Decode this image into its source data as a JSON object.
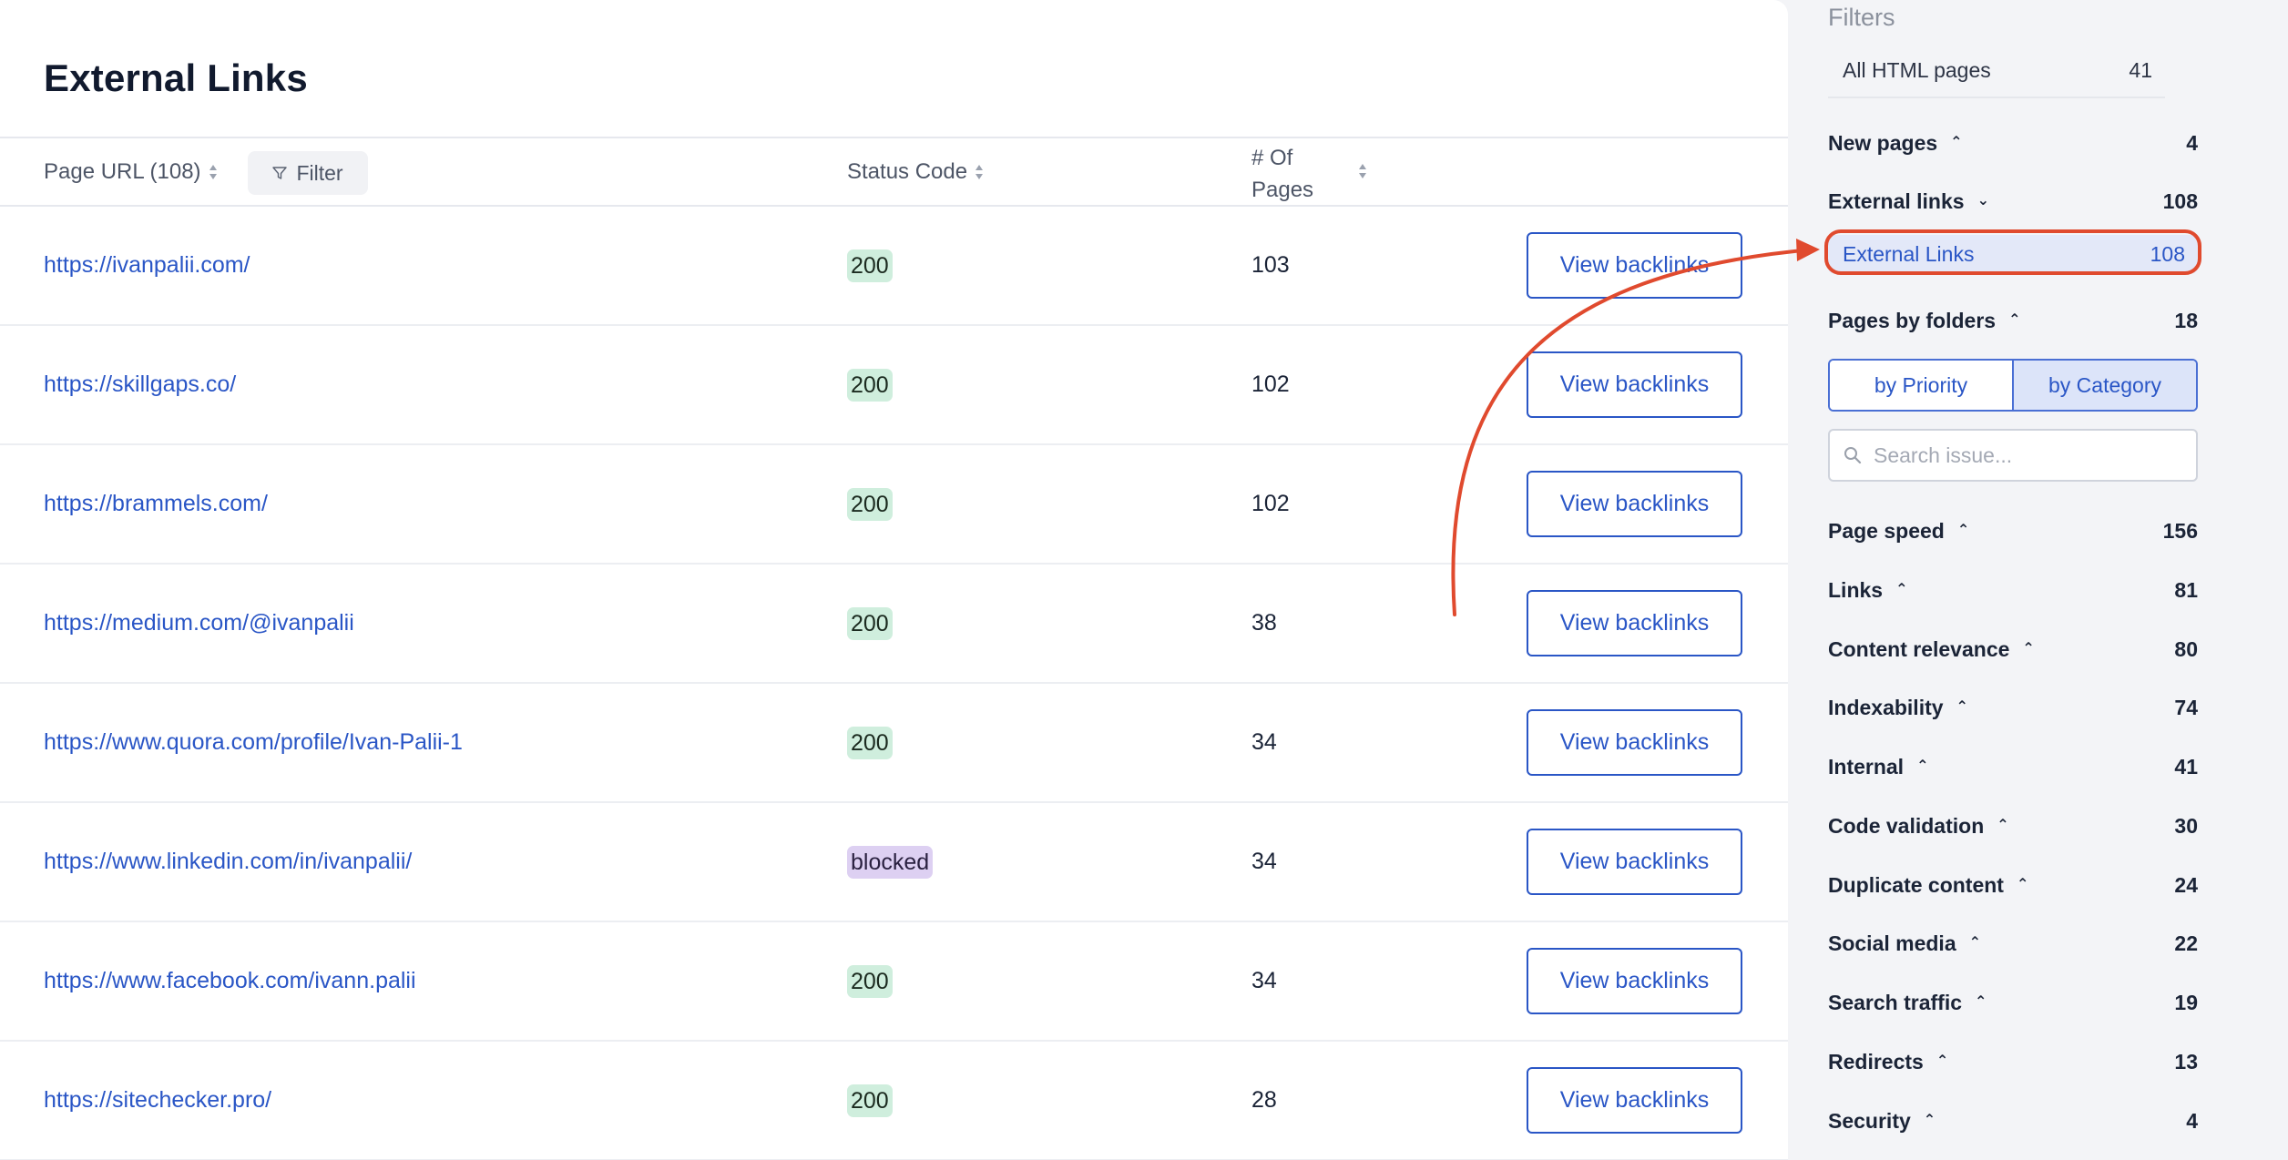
{
  "main": {
    "title": "External Links",
    "columns": {
      "url": "Page URL (108)",
      "filter": "Filter",
      "status": "Status Code",
      "pages": "# Of Pages"
    },
    "rows": [
      {
        "url": "https://ivanpalii.com/",
        "status": "200",
        "status_type": "ok",
        "pages": "103",
        "action": "View backlinks"
      },
      {
        "url": "https://skillgaps.co/",
        "status": "200",
        "status_type": "ok",
        "pages": "102",
        "action": "View backlinks"
      },
      {
        "url": "https://brammels.com/",
        "status": "200",
        "status_type": "ok",
        "pages": "102",
        "action": "View backlinks"
      },
      {
        "url": "https://medium.com/@ivanpalii",
        "status": "200",
        "status_type": "ok",
        "pages": "38",
        "action": "View backlinks"
      },
      {
        "url": "https://www.quora.com/profile/Ivan-Palii-1",
        "status": "200",
        "status_type": "ok",
        "pages": "34",
        "action": "View backlinks"
      },
      {
        "url": "https://www.linkedin.com/in/ivanpalii/",
        "status": "blocked",
        "status_type": "blocked",
        "pages": "34",
        "action": "View backlinks"
      },
      {
        "url": "https://www.facebook.com/ivann.palii",
        "status": "200",
        "status_type": "ok",
        "pages": "34",
        "action": "View backlinks"
      },
      {
        "url": "https://sitechecker.pro/",
        "status": "200",
        "status_type": "ok",
        "pages": "28",
        "action": "View backlinks"
      }
    ]
  },
  "sidebar": {
    "title": "Filters",
    "all": {
      "label": "All HTML pages",
      "count": "41"
    },
    "new_pages": {
      "label": "New pages",
      "count": "4"
    },
    "external_links": {
      "label": "External links",
      "count": "108"
    },
    "external_links_sub": {
      "label": "External Links",
      "count": "108"
    },
    "pages_by_folders": {
      "label": "Pages by folders",
      "count": "18"
    },
    "segmented": {
      "priority": "by Priority",
      "category": "by Category",
      "active": "category"
    },
    "search": {
      "placeholder": "Search issue..."
    },
    "categories": [
      {
        "label": "Page speed",
        "count": "156"
      },
      {
        "label": "Links",
        "count": "81"
      },
      {
        "label": "Content relevance",
        "count": "80"
      },
      {
        "label": "Indexability",
        "count": "74"
      },
      {
        "label": "Internal",
        "count": "41"
      },
      {
        "label": "Code validation",
        "count": "30"
      },
      {
        "label": "Duplicate content",
        "count": "24"
      },
      {
        "label": "Social media",
        "count": "22"
      },
      {
        "label": "Search traffic",
        "count": "19"
      },
      {
        "label": "Redirects",
        "count": "13"
      },
      {
        "label": "Security",
        "count": "4"
      }
    ]
  },
  "colors": {
    "accent": "#2a56c6",
    "annotation": "#e04a2e",
    "badge_ok": "#cfeedd",
    "badge_blocked": "#ddd0f2"
  }
}
